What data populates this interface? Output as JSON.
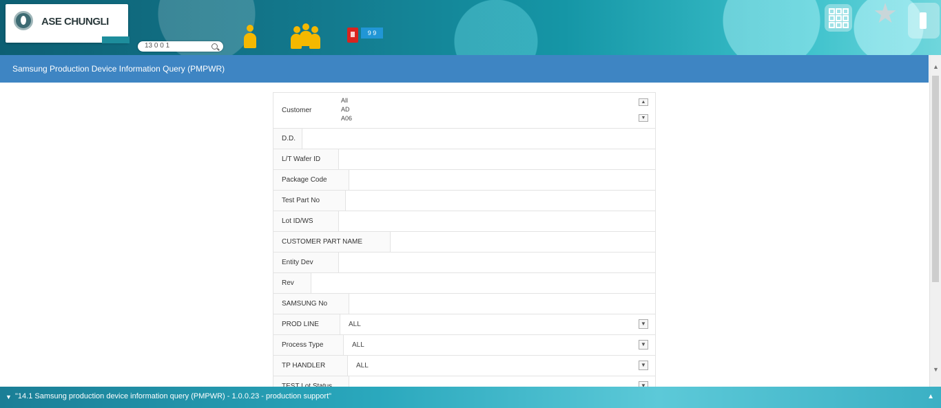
{
  "header": {
    "logo_text": "ASE CHUNGLI",
    "logo_tag": "",
    "search_value": "13 0 0 1",
    "blue_tag": "9 9"
  },
  "title": "Samsung Production Device Information Query (PMPWR)",
  "form": {
    "list_label": "Customer",
    "list_options": [
      "All",
      "AD",
      "A06"
    ],
    "rows": [
      {
        "label": "D.D.",
        "value": ""
      },
      {
        "label": "L/T Wafer ID",
        "value": ""
      },
      {
        "label": "Package Code",
        "value": ""
      },
      {
        "label": "Test Part No",
        "value": ""
      },
      {
        "label": "Lot ID/WS",
        "value": ""
      },
      {
        "label": "CUSTOMER PART NAME",
        "value": ""
      },
      {
        "label": "Entity Dev",
        "value": ""
      },
      {
        "label": "Rev",
        "value": ""
      },
      {
        "label": "SAMSUNG No",
        "value": ""
      },
      {
        "label": "PROD LINE",
        "value": "ALL",
        "dropdown": true
      },
      {
        "label": "Process Type",
        "value": "ALL",
        "dropdown": true
      },
      {
        "label": "TP HANDLER",
        "value": "ALL",
        "dropdown": true
      },
      {
        "label": "TEST Lot Status",
        "value": "",
        "dropdown": true
      }
    ]
  },
  "statusbar": {
    "text": "\"14.1 Samsung production device information query (PMPWR) - 1.0.0.23 - production support\""
  }
}
